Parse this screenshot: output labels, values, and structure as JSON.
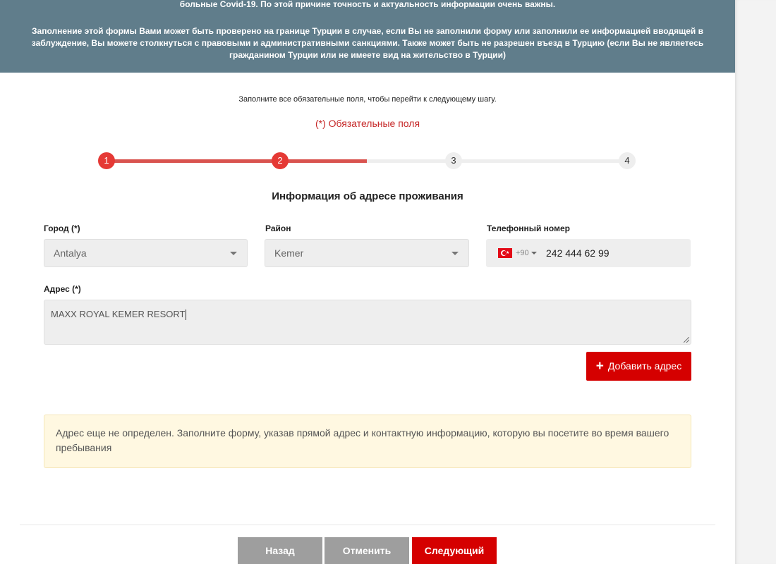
{
  "banner": {
    "line1": "больные Covid-19. По этой причине точность и актуальность информации очень важны.",
    "paragraph2": "Заполнение этой формы Вами может быть проверено на границе Турции в случае, если Вы не заполнили форму или заполнили ее информацией вводящей в заблуждение, Вы можете столкнуться с правовыми и административными санкциями. Также может быть не разрешен въезд в Турцию (если Вы не являетесь гражданином Турции или не имеете вид на жительство в Турции)",
    "background_color": "#607d8b"
  },
  "form": {
    "hint": "Заполните все обязательные поля, чтобы перейти к следующему шагу.",
    "required_note": "(*) Обязательные поля",
    "stepper": {
      "steps": [
        "1",
        "2",
        "3",
        "4"
      ],
      "current_step": 2,
      "progress": 0.5
    },
    "section_title": "Информация об адресе проживания",
    "city": {
      "label": "Город (*)",
      "value": "Antalya"
    },
    "district": {
      "label": "Район",
      "value": "Kemer"
    },
    "phone": {
      "label": "Телефонный номер",
      "country_code": "+90",
      "value": "242 444 62 99",
      "flag_icon": "turkey-flag-icon"
    },
    "address": {
      "label": "Адрес (*)",
      "value": "MAXX ROYAL KEMER RESORT"
    },
    "add_address_label": "Добавить адрес",
    "warning": "Адрес еще не определен. Заполните форму, указав прямой адрес и контактную информацию, которую вы посетите во время вашего пребывания"
  },
  "footer": {
    "back_label": "Назад",
    "cancel_label": "Отменить",
    "next_label": "Следующий"
  },
  "colors": {
    "accent": "#d50000",
    "step_active": "#e53935",
    "step_track": "#d9534f",
    "warning_bg": "#fff8e1"
  }
}
